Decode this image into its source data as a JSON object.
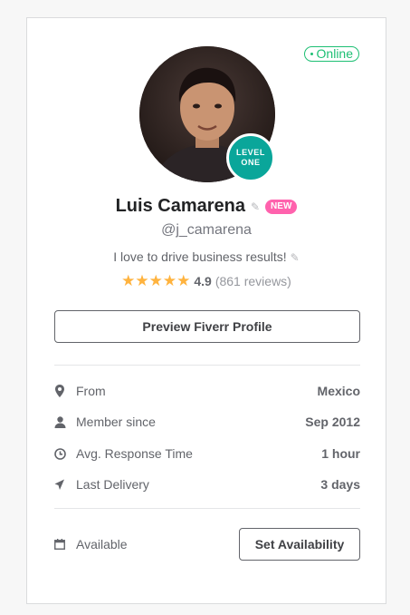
{
  "status": {
    "label": "Online",
    "color": "#1dbf73"
  },
  "profile": {
    "avatar_icon": "user-photo",
    "level_badge": {
      "line1": "LEVEL",
      "line2": "ONE",
      "color": "#0aa69a"
    },
    "name": "Luis Camarena",
    "new_badge": "NEW",
    "username": "@j_camarena",
    "tagline": "I love to drive business results!",
    "rating": {
      "stars": "★★★★★",
      "score": "4.9",
      "reviews": "(861 reviews)"
    }
  },
  "buttons": {
    "preview": "Preview Fiverr Profile",
    "set_availability": "Set Availability"
  },
  "info": [
    {
      "icon": "location-pin-icon",
      "label": "From",
      "value": "Mexico"
    },
    {
      "icon": "user-icon",
      "label": "Member since",
      "value": "Sep 2012"
    },
    {
      "icon": "clock-icon",
      "label": "Avg. Response Time",
      "value": "1 hour"
    },
    {
      "icon": "send-icon",
      "label": "Last Delivery",
      "value": "3 days"
    }
  ],
  "availability": {
    "icon": "calendar-icon",
    "label": "Available"
  },
  "colors": {
    "accent_green": "#1dbf73",
    "new_pink": "#ff62ad",
    "star": "#ffb33e"
  }
}
